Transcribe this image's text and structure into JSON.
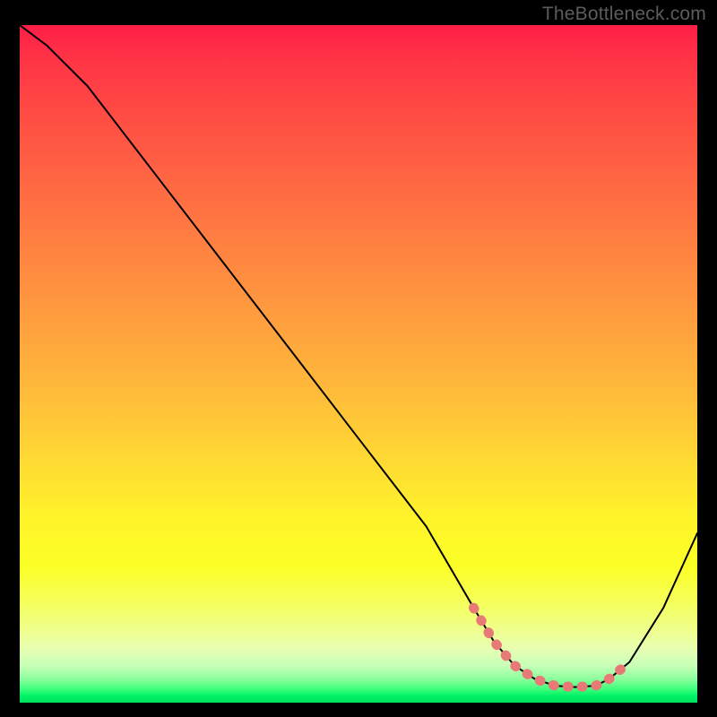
{
  "watermark": "TheBottleneck.com",
  "chart_data": {
    "type": "line",
    "title": "",
    "xlabel": "",
    "ylabel": "",
    "xlim": [
      0,
      100
    ],
    "ylim": [
      0,
      100
    ],
    "curve": {
      "x": [
        0,
        4,
        10,
        20,
        30,
        40,
        50,
        60,
        67,
        70,
        73,
        76,
        79,
        82,
        85,
        87,
        90,
        95,
        100
      ],
      "y": [
        100,
        97,
        91,
        78,
        65,
        52,
        39,
        26,
        14,
        9,
        5.5,
        3.5,
        2.5,
        2.3,
        2.5,
        3.5,
        6,
        14,
        25
      ]
    },
    "highlight_segment": {
      "x": [
        67,
        70,
        73,
        76,
        79,
        82,
        85,
        87,
        90
      ],
      "y": [
        14,
        9,
        5.5,
        3.5,
        2.5,
        2.3,
        2.5,
        3.5,
        6
      ]
    },
    "colors": {
      "curve": "#000000",
      "highlight": "#e77a76",
      "background_top": "#ff1f47",
      "background_bottom": "#00e25f"
    }
  }
}
